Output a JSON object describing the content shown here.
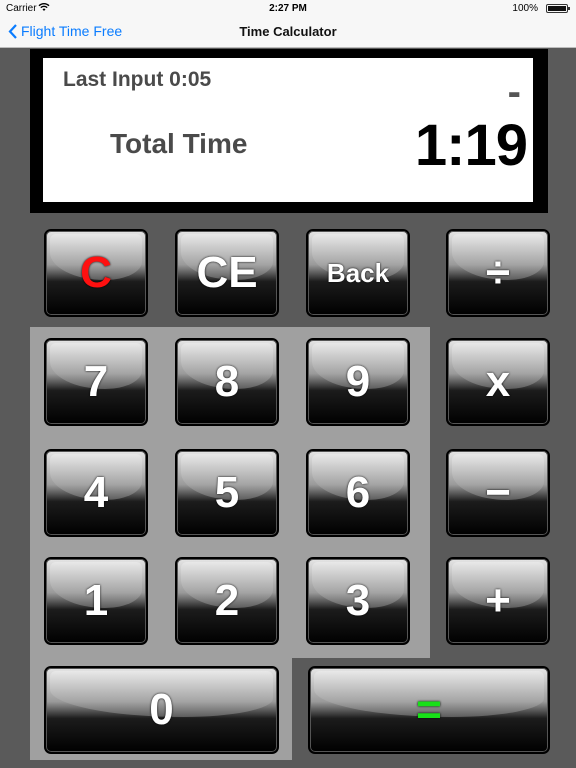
{
  "status_bar": {
    "carrier": "Carrier",
    "time": "2:27 PM",
    "battery": "100%"
  },
  "nav": {
    "back_label": "Flight Time Free",
    "title": "Time Calculator"
  },
  "display": {
    "last_input": "Last Input 0:05",
    "operator": "-",
    "total_label": "Total Time",
    "total_value": "1:19"
  },
  "keys": {
    "clear": "C",
    "clear_entry": "CE",
    "back": "Back",
    "divide": "÷",
    "seven": "7",
    "eight": "8",
    "nine": "9",
    "multiply": "x",
    "four": "4",
    "five": "5",
    "six": "6",
    "minus": "−",
    "one": "1",
    "two": "2",
    "three": "3",
    "plus": "+",
    "zero": "0",
    "equals": "="
  },
  "colors": {
    "clear_text": "#ff1010",
    "equals_text": "#18e018",
    "back_link": "#0a7cff"
  }
}
